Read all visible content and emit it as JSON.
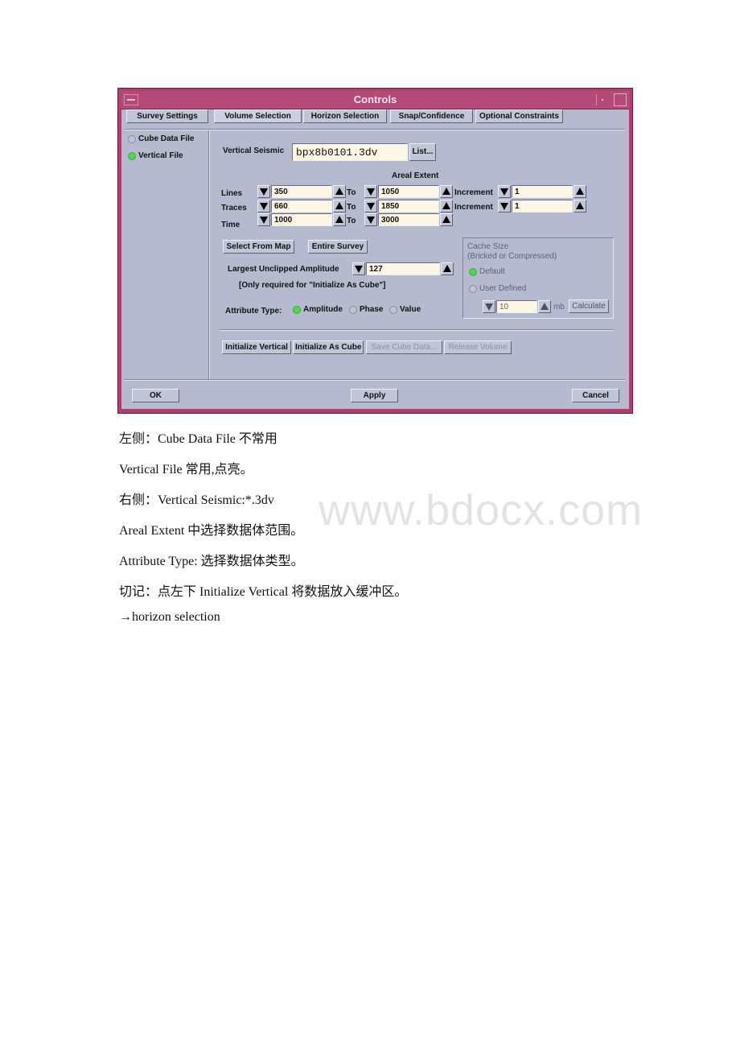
{
  "window": {
    "title": "Controls",
    "tabs": [
      {
        "label": "Survey Settings",
        "active": false
      },
      {
        "label": "Volume Selection",
        "active": true
      },
      {
        "label": "Horizon Selection",
        "active": false
      },
      {
        "label": "Snap/Confidence",
        "active": false
      },
      {
        "label": "Optional Constraints",
        "active": false
      }
    ]
  },
  "source": {
    "options": [
      {
        "label": "Cube Data File",
        "selected": false
      },
      {
        "label": "Vertical File",
        "selected": true
      }
    ]
  },
  "vertical_seismic": {
    "label": "Vertical Seismic",
    "value": "bpx8b0101.3dv",
    "list_button": "List..."
  },
  "areal_extent": {
    "heading": "Areal Extent",
    "to_label": "To",
    "increment_label": "Increment",
    "rows": [
      {
        "label": "Lines",
        "from": "350",
        "to": "1050",
        "increment": "1"
      },
      {
        "label": "Traces",
        "from": "660",
        "to": "1850",
        "increment": "1"
      },
      {
        "label": "Time",
        "from": "1000",
        "to": "3000"
      }
    ]
  },
  "map_buttons": {
    "select_from_map": "Select From Map",
    "entire_survey": "Entire Survey"
  },
  "amplitude": {
    "label": "Largest Unclipped Amplitude",
    "value": "127",
    "note": "[Only required for \"Initialize As Cube\"]"
  },
  "attribute_type": {
    "label": "Attribute Type:",
    "options": [
      {
        "label": "Amplitude",
        "selected": true
      },
      {
        "label": "Phase",
        "selected": false
      },
      {
        "label": "Value",
        "selected": false
      }
    ]
  },
  "cache": {
    "title_line1": "Cache Size",
    "title_line2": "(Bricked or Compressed)",
    "options": [
      {
        "label": "Default",
        "selected": true
      },
      {
        "label": "User Defined",
        "selected": false
      }
    ],
    "value": "10",
    "unit": "mb",
    "calculate": "Calculate"
  },
  "actions": {
    "initialize_vertical": "Initialize Vertical",
    "initialize_cube": "Initialize As Cube",
    "save_cube": "Save Cube Data...",
    "release_volume": "Release Volume"
  },
  "footer": {
    "ok": "OK",
    "apply": "Apply",
    "cancel": "Cancel"
  },
  "document": {
    "lines": [
      "左侧：Cube Data File 不常用",
      "Vertical File 常用,点亮。",
      "右侧：Vertical Seismic:*.3dv",
      " Areal Extent 中选择数据体范围。",
      " Attribute Type: 选择数据体类型。",
      "切记：点左下 Initialize Vertical 将数据放入缓冲区。",
      " →horizon selection"
    ],
    "watermark": "www.bdocx.com"
  },
  "colors": {
    "titlebar": "#b44a78",
    "panel": "#b6bacf",
    "field": "#fdf6e4",
    "radio_on": "#3ee23a"
  }
}
